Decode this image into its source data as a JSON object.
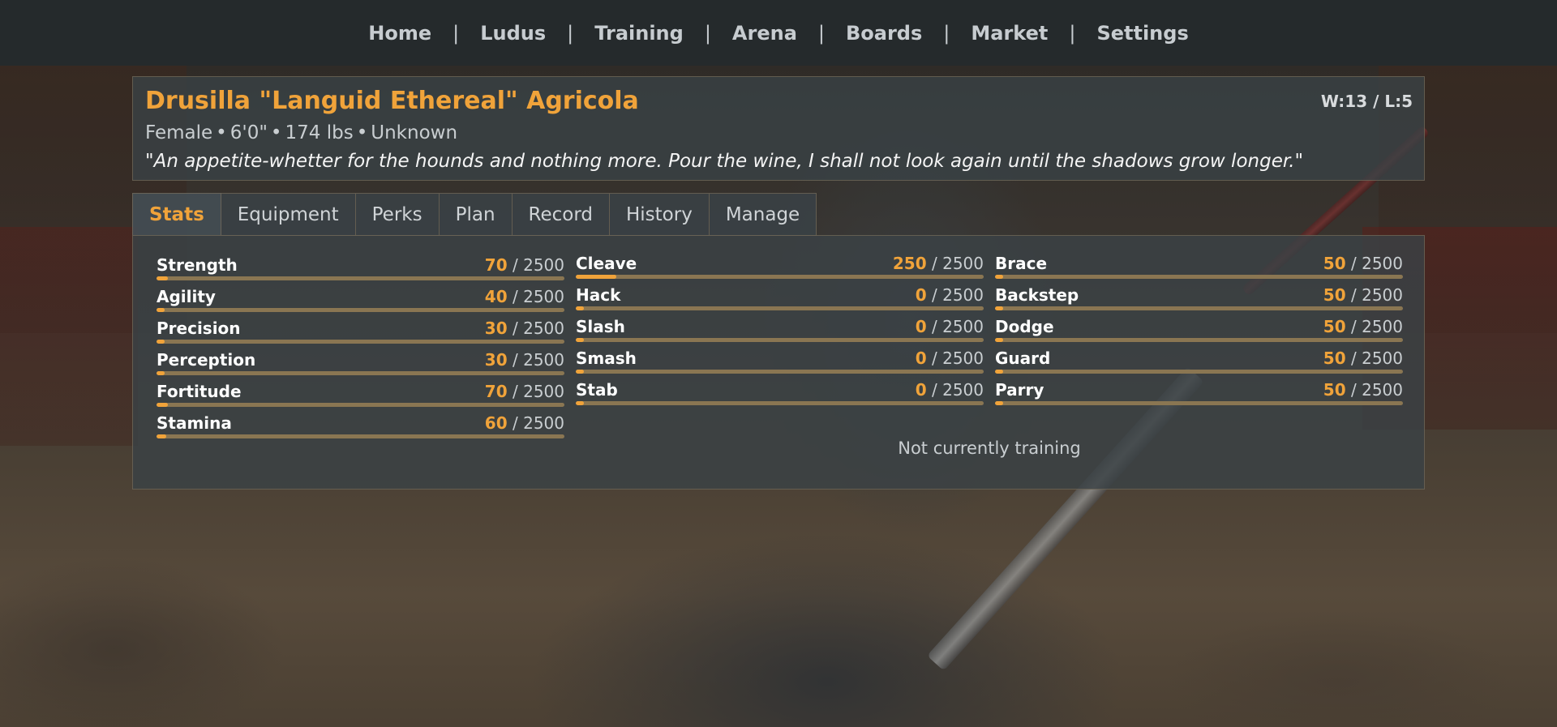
{
  "nav": {
    "items": [
      "Home",
      "Ludus",
      "Training",
      "Arena",
      "Boards",
      "Market",
      "Settings"
    ],
    "separator": "|"
  },
  "gladiator": {
    "name": "Drusilla \"Languid Ethereal\" Agricola",
    "record": "W:13 / L:5",
    "gender": "Female",
    "height": "6'0\"",
    "weight": "174 lbs",
    "origin": "Unknown",
    "meta_separator": "•",
    "quote": "\"An appetite-whetter for the hounds and nothing more. Pour the wine, I shall not look again until the shadows grow longer.\""
  },
  "tabs": [
    {
      "label": "Stats",
      "active": true
    },
    {
      "label": "Equipment",
      "active": false
    },
    {
      "label": "Perks",
      "active": false
    },
    {
      "label": "Plan",
      "active": false
    },
    {
      "label": "Record",
      "active": false
    },
    {
      "label": "History",
      "active": false
    },
    {
      "label": "Manage",
      "active": false
    }
  ],
  "stats": {
    "max": "2500",
    "divider": "/",
    "attributes": [
      {
        "name": "Strength",
        "value": 70
      },
      {
        "name": "Agility",
        "value": 40
      },
      {
        "name": "Precision",
        "value": 30
      },
      {
        "name": "Perception",
        "value": 30
      },
      {
        "name": "Fortitude",
        "value": 70
      },
      {
        "name": "Stamina",
        "value": 60
      }
    ],
    "offense": [
      {
        "name": "Cleave",
        "value": 250
      },
      {
        "name": "Hack",
        "value": 0
      },
      {
        "name": "Slash",
        "value": 0
      },
      {
        "name": "Smash",
        "value": 0
      },
      {
        "name": "Stab",
        "value": 0
      }
    ],
    "defense": [
      {
        "name": "Brace",
        "value": 50
      },
      {
        "name": "Backstep",
        "value": 50
      },
      {
        "name": "Dodge",
        "value": 50
      },
      {
        "name": "Guard",
        "value": 50
      },
      {
        "name": "Parry",
        "value": 50
      }
    ],
    "training_status": "Not currently training"
  },
  "colors": {
    "accent": "#f0a33a",
    "nav_bg": "#252a2c",
    "panel_bg": "#3a4246",
    "bar_track": "#8a7652"
  }
}
